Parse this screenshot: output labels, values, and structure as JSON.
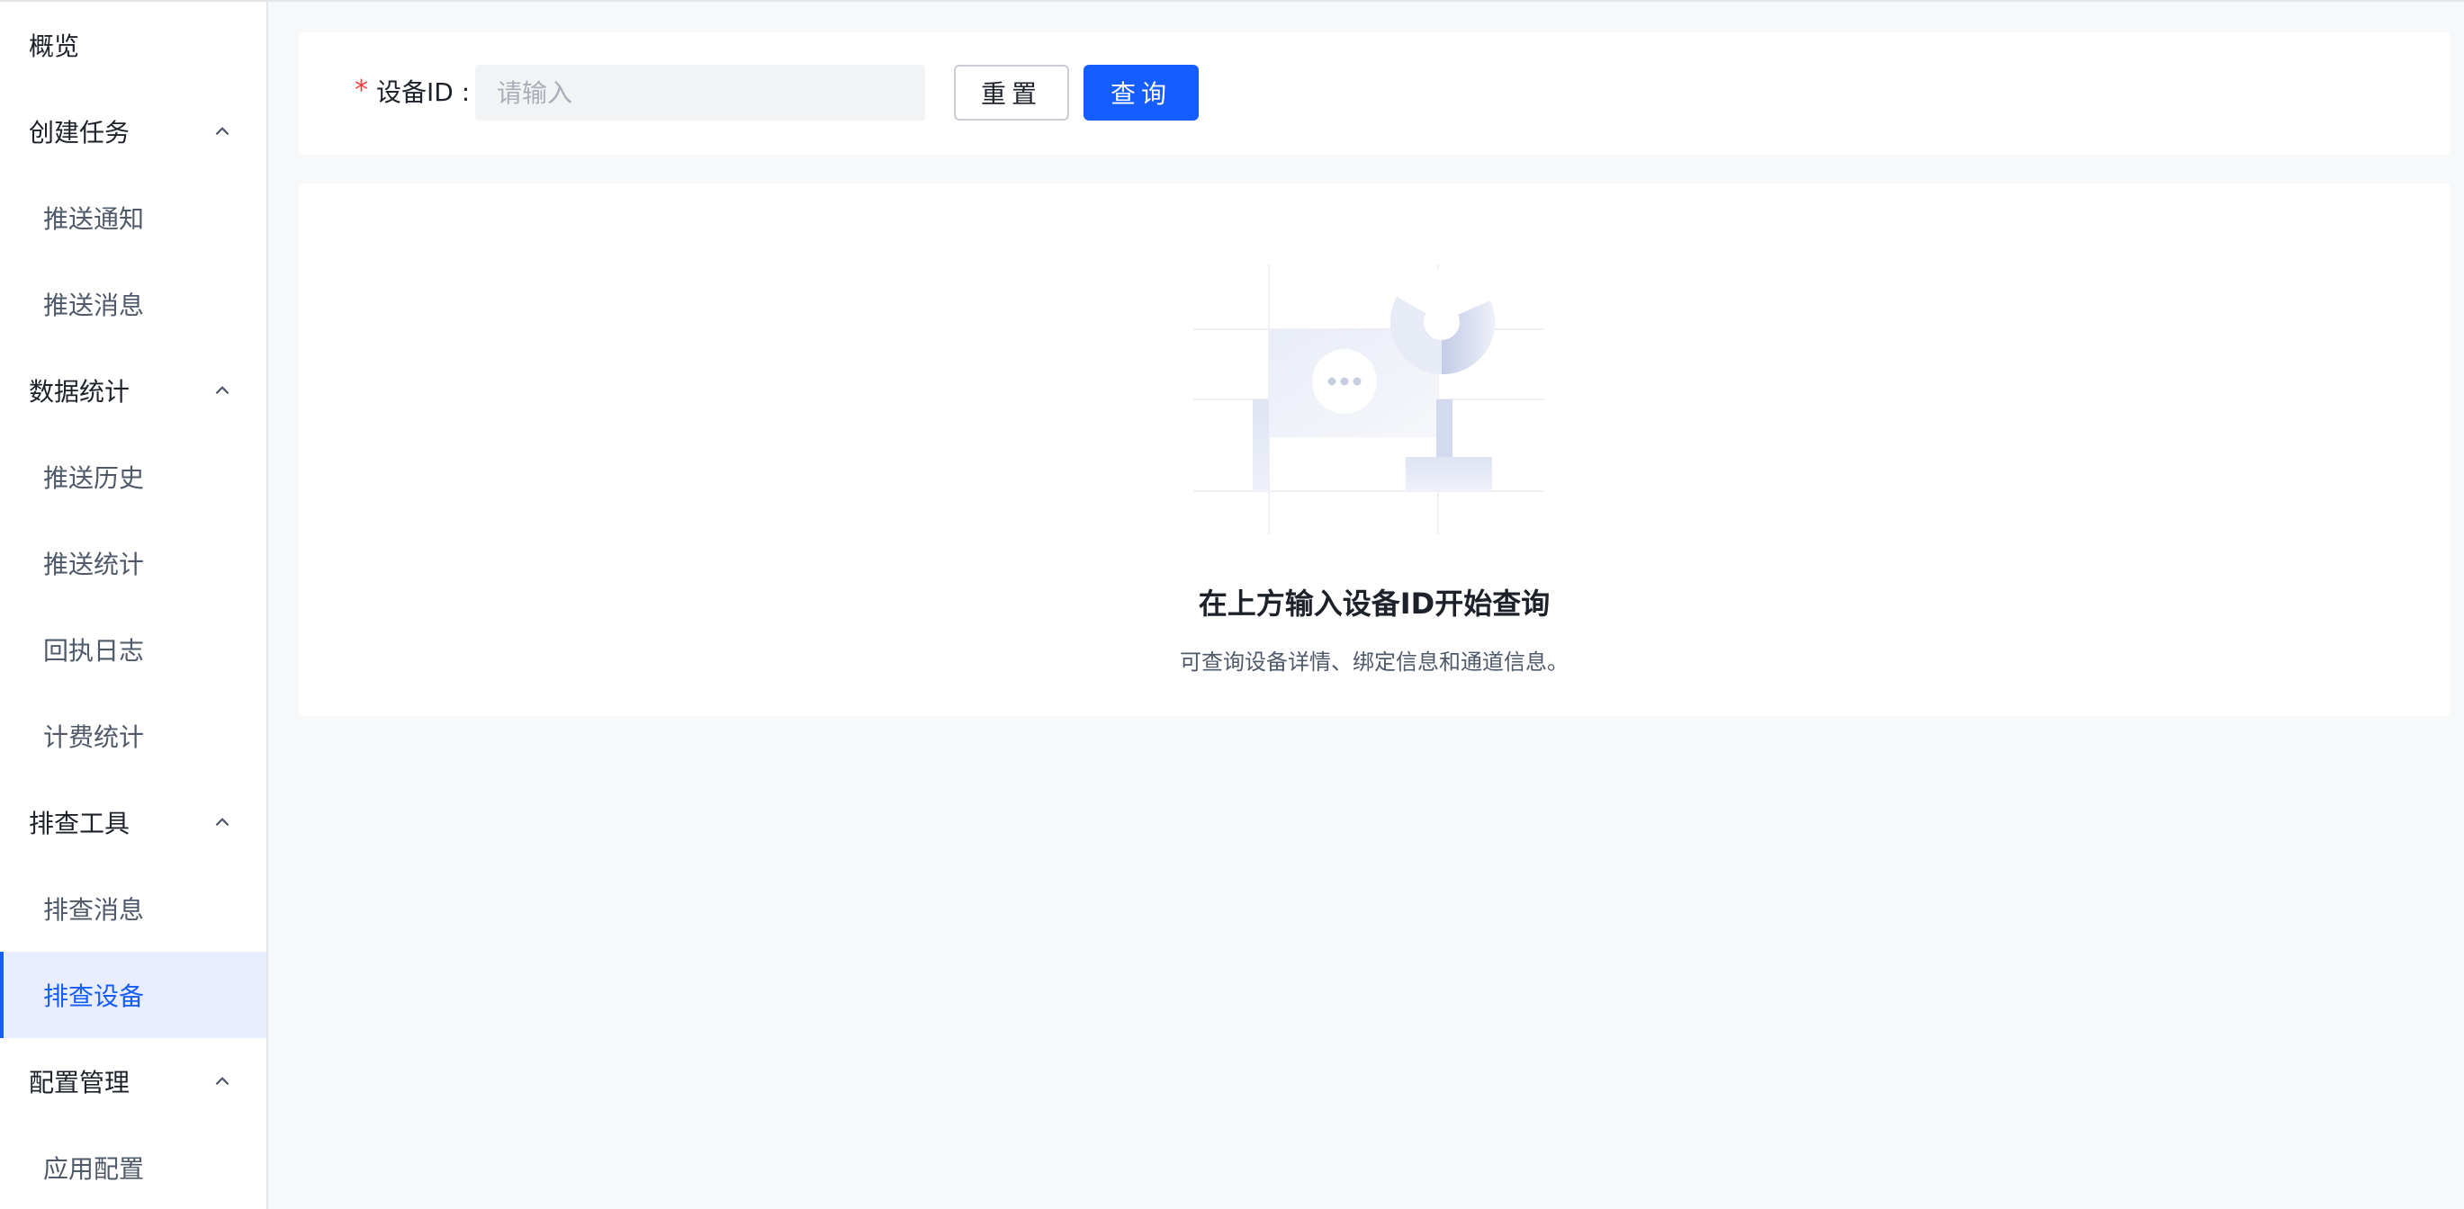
{
  "sidebar": {
    "overview": "概览",
    "groups": [
      {
        "title": "创建任务",
        "items": [
          "推送通知",
          "推送消息"
        ]
      },
      {
        "title": "数据统计",
        "items": [
          "推送历史",
          "推送统计",
          "回执日志",
          "计费统计"
        ]
      },
      {
        "title": "排查工具",
        "items": [
          "排查消息",
          "排查设备"
        ]
      },
      {
        "title": "配置管理",
        "items": [
          "应用配置"
        ]
      }
    ],
    "active_item": "排查设备"
  },
  "search": {
    "required_mark": "*",
    "label": "设备ID :",
    "placeholder": "请输入",
    "value": "",
    "reset_label": "重置",
    "query_label": "查询"
  },
  "empty_state": {
    "title": "在上方输入设备ID开始查询",
    "description": "可查询设备详情、绑定信息和通道信息。",
    "icon": "empty-search-illustration"
  },
  "colors": {
    "primary": "#165dff",
    "active_bg": "#e8eeff",
    "required": "#f53f3f",
    "page_bg": "#f7f8fa"
  }
}
